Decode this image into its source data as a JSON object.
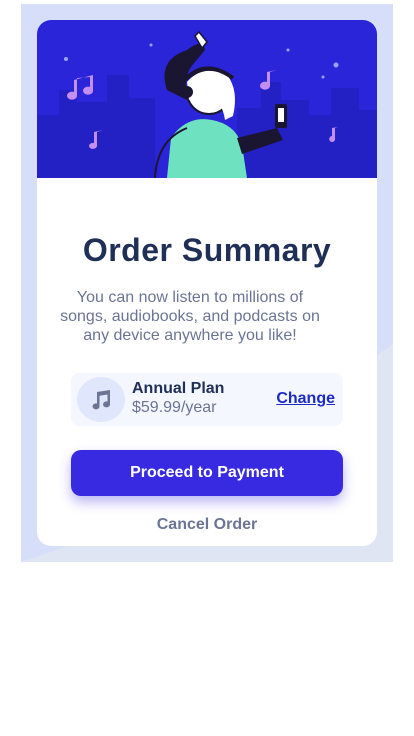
{
  "summary": {
    "title": "Order Summary",
    "description": "You can now listen to millions of songs, audiobooks, and podcasts on any device anywhere you like!"
  },
  "plan": {
    "name": "Annual Plan",
    "price": "$59.99/year",
    "change_label": "Change",
    "icon": "music-note-icon"
  },
  "actions": {
    "proceed_label": "Proceed to Payment",
    "cancel_label": "Cancel Order"
  },
  "colors": {
    "accent": "#382ae1",
    "hero_bg": "#2a25d8",
    "title": "#1f2f56",
    "muted": "#6b7593",
    "page_bg": "#d7defa",
    "link": "#1b2bc9"
  }
}
